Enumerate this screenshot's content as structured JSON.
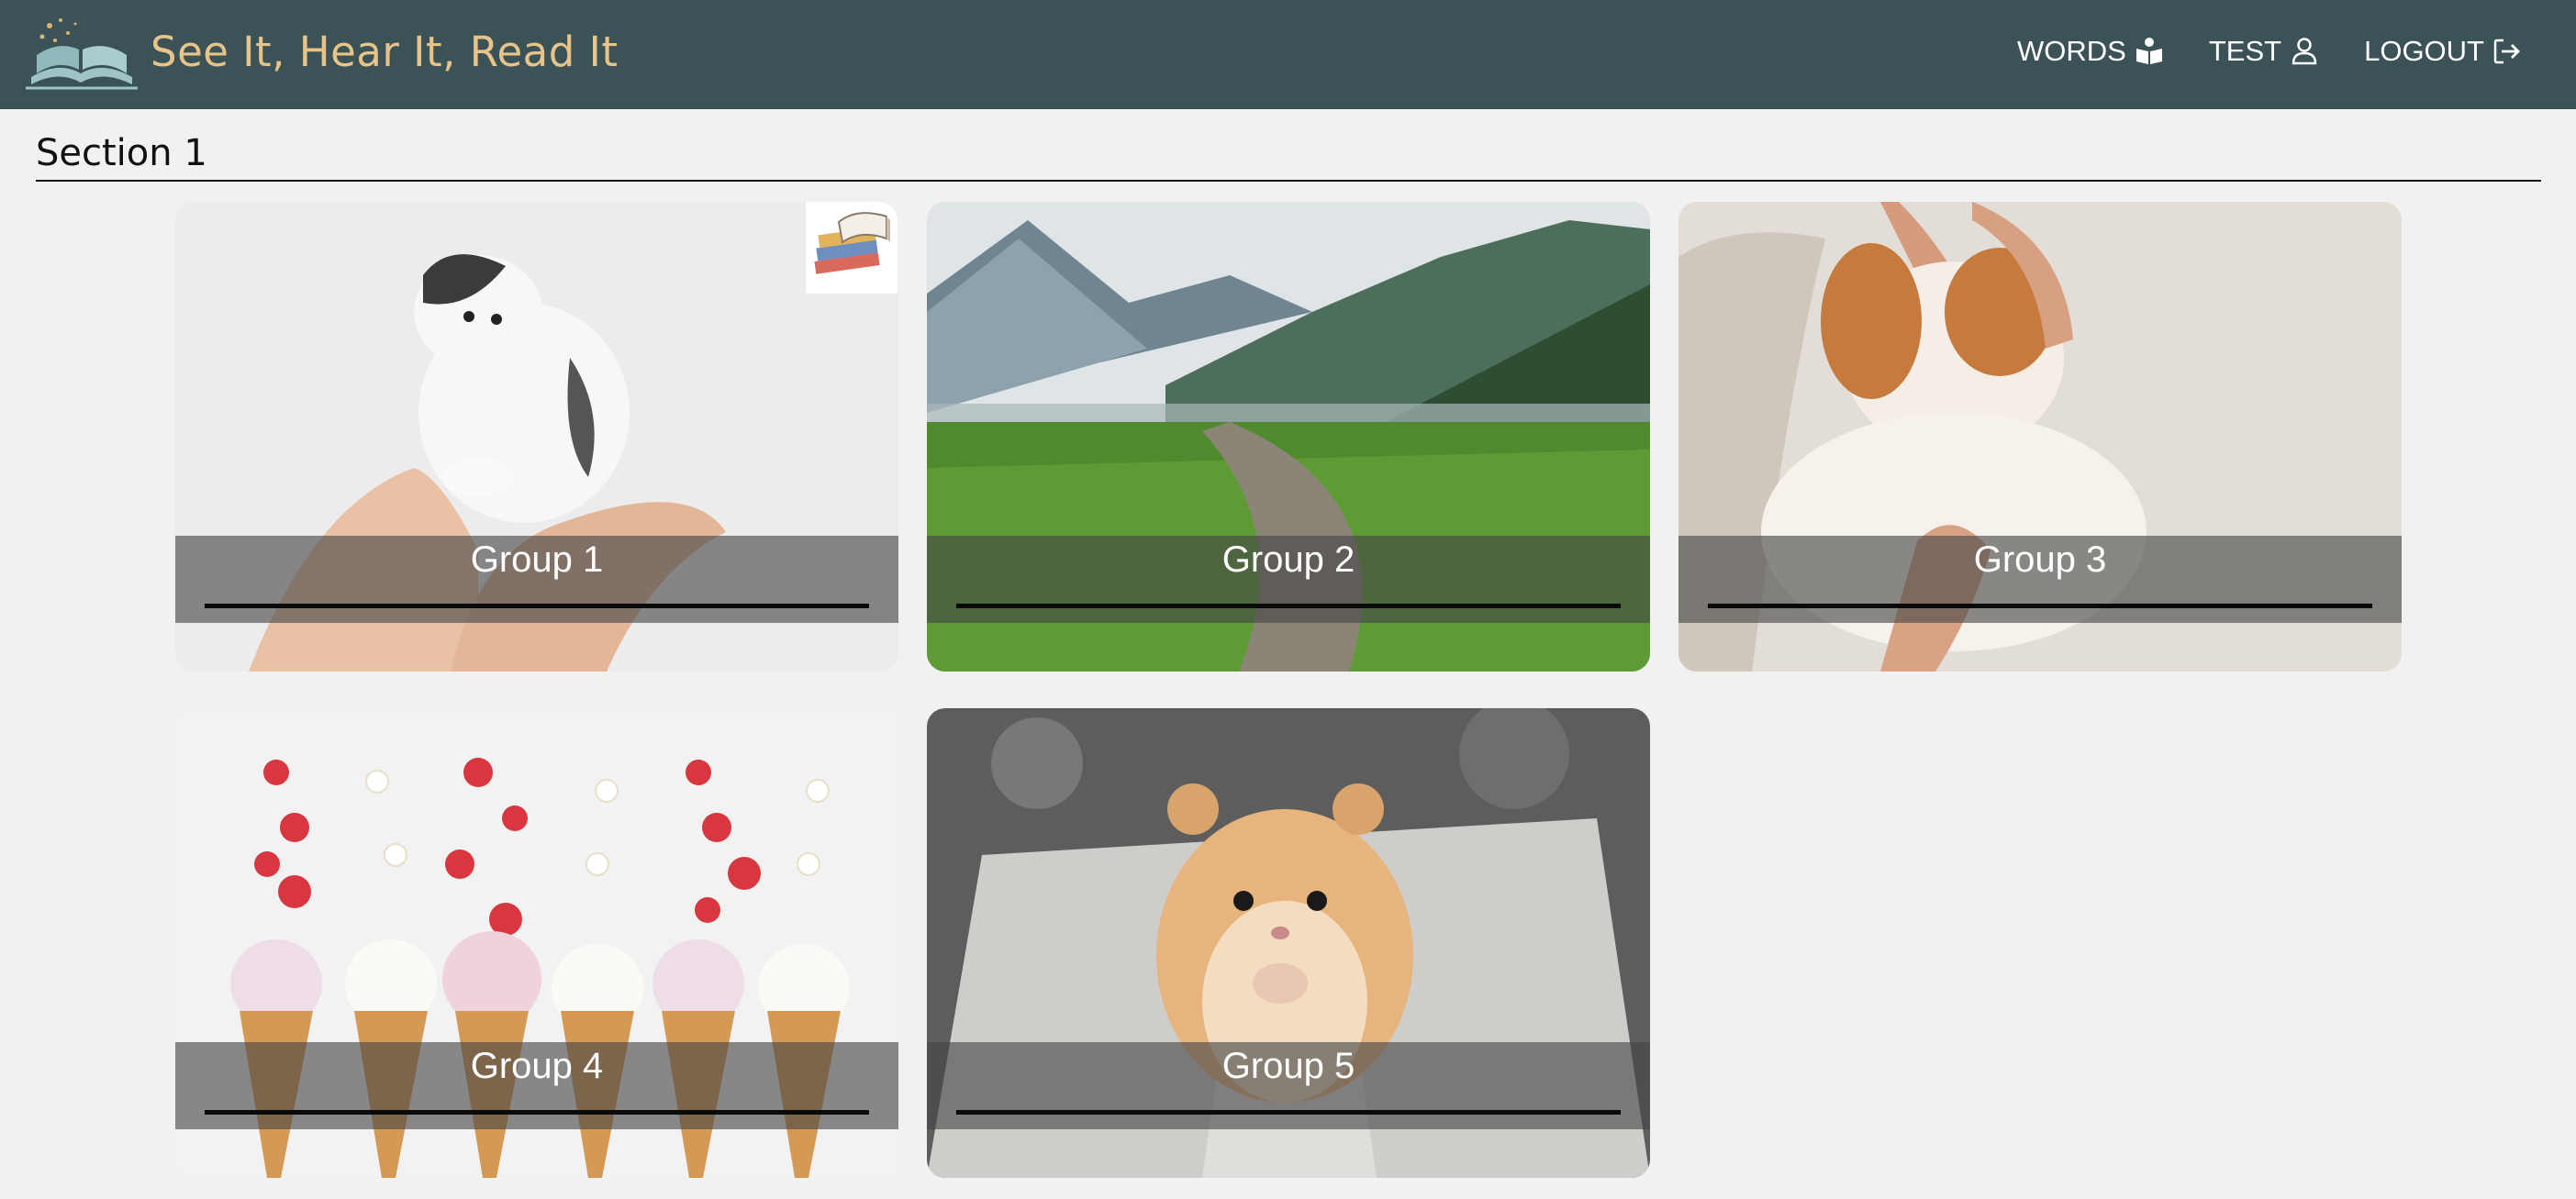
{
  "app": {
    "title": "See It, Hear It, Read It"
  },
  "nav": [
    {
      "label": "WORDS",
      "icon": "book-reader-icon"
    },
    {
      "label": "TEST",
      "icon": "user-icon"
    },
    {
      "label": "LOGOUT",
      "icon": "logout-icon"
    }
  ],
  "section": {
    "title": "Section 1"
  },
  "groups": [
    {
      "label": "Group 1",
      "image": "kitten-photo"
    },
    {
      "label": "Group 2",
      "image": "mountain-path-photo"
    },
    {
      "label": "Group 3",
      "image": "puppy-photo"
    },
    {
      "label": "Group 4",
      "image": "ice-cream-strawberries-photo"
    },
    {
      "label": "Group 5",
      "image": "hamster-photo"
    }
  ],
  "colors": {
    "navbar": "#3b5257",
    "brand": "#e8c48a",
    "background": "#f1f1f1"
  }
}
